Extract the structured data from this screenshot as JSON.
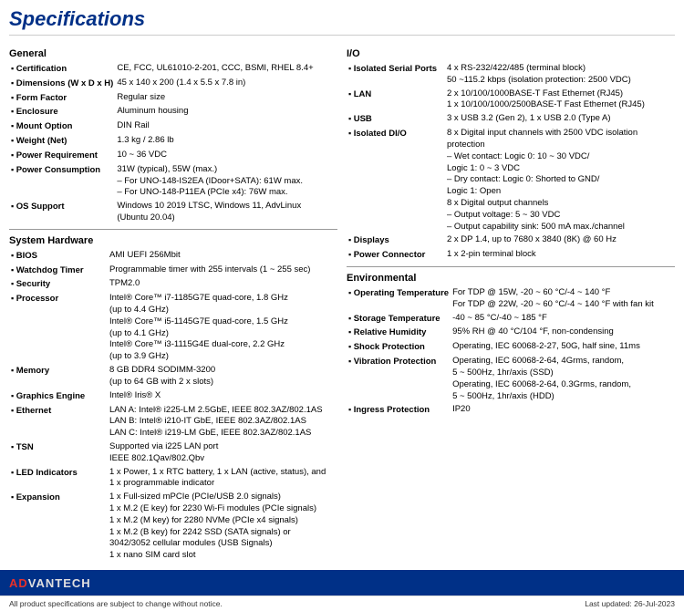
{
  "title": "Specifications",
  "left": {
    "general": {
      "heading": "General",
      "rows": [
        {
          "label": "Certification",
          "value": "CE, FCC, UL61010-2-201, CCC, BSMI, RHEL 8.4+"
        },
        {
          "label": "Dimensions (W x D x H)",
          "value": "45 x 140 x 200 (1.4 x 5.5 x 7.8 in)"
        },
        {
          "label": "Form Factor",
          "value": "Regular size"
        },
        {
          "label": "Enclosure",
          "value": "Aluminum housing"
        },
        {
          "label": "Mount Option",
          "value": "DIN Rail"
        },
        {
          "label": "Weight (Net)",
          "value": "1.3 kg / 2.86 lb"
        },
        {
          "label": "Power Requirement",
          "value": "10 ~ 36 VDC"
        },
        {
          "label": "Power Consumption",
          "value": "31W (typical), 55W (max.)\n– For UNO-148-IS2EA (IDoor+SATA): 61W max.\n– For UNO-148-P11EA (PCIe x4): 76W max."
        },
        {
          "label": "OS Support",
          "value": "Windows 10 2019 LTSC, Windows 11, AdvLinux\n(Ubuntu 20.04)"
        }
      ]
    },
    "system": {
      "heading": "System Hardware",
      "rows": [
        {
          "label": "BIOS",
          "value": "AMI UEFI 256Mbit"
        },
        {
          "label": "Watchdog Timer",
          "value": "Programmable timer with 255 intervals (1 ~ 255 sec)"
        },
        {
          "label": "Security",
          "value": "TPM2.0"
        },
        {
          "label": "Processor",
          "value": "Intel® Core™ i7-1185G7E quad-core, 1.8 GHz\n(up to 4.4 GHz)\nIntel® Core™ i5-1145G7E quad-core, 1.5 GHz\n(up to 4.1 GHz)\nIntel® Core™ i3-1115G4E dual-core, 2.2 GHz\n(up to 3.9 GHz)"
        },
        {
          "label": "Memory",
          "value": "8 GB DDR4 SODIMM-3200\n(up to 64 GB with 2 x slots)"
        },
        {
          "label": "Graphics Engine",
          "value": "Intel® Iris® X"
        },
        {
          "label": "Ethernet",
          "value": "LAN A: Intel® i225-LM 2.5GbE, IEEE 802.3AZ/802.1AS\nLAN B: Intel® i210-IT GbE, IEEE 802.3AZ/802.1AS\nLAN C: Intel® i219-LM GbE, IEEE 802.3AZ/802.1AS"
        },
        {
          "label": "TSN",
          "value": "Supported via i225 LAN port\nIEEE 802.1Qav/802.Qbv"
        },
        {
          "label": "LED Indicators",
          "value": "1 x Power, 1 x RTC battery, 1 x LAN (active, status), and\n1 x programmable indicator"
        },
        {
          "label": "Expansion",
          "value": "1 x Full-sized mPCIe (PCIe/USB 2.0 signals)\n1 x M.2 (E key) for 2230 Wi-Fi modules (PCIe signals)\n1 x M.2 (M key) for 2280 NVMe (PCIe x4 signals)\n1 x M.2 (B key) for 2242 SSD (SATA signals) or\n3042/3052 cellular modules (USB Signals)\n1 x nano SIM card slot"
        }
      ]
    }
  },
  "right": {
    "io": {
      "heading": "I/O",
      "rows": [
        {
          "label": "Isolated Serial Ports",
          "value": "4 x RS-232/422/485 (terminal block)\n50 ~115.2 kbps (isolation protection: 2500 VDC)"
        },
        {
          "label": "LAN",
          "value": "2 x 10/100/1000BASE-T Fast Ethernet (RJ45)\n1 x 10/100/1000/2500BASE-T Fast Ethernet (RJ45)"
        },
        {
          "label": "USB",
          "value": "3 x USB 3.2 (Gen 2), 1 x USB 2.0 (Type A)"
        },
        {
          "label": "Isolated DI/O",
          "value": "8 x Digital input channels with 2500 VDC isolation\nprotection\n– Wet contact: Logic 0: 10 ~ 30 VDC/\n  Logic 1: 0 ~ 3 VDC\n– Dry contact: Logic 0: Shorted to GND/\n  Logic 1: Open\n8 x Digital output channels\n– Output voltage: 5 ~ 30 VDC\n– Output capability sink: 500 mA max./channel"
        },
        {
          "label": "Displays",
          "value": "2 x DP 1.4, up to 7680 x 3840 (8K) @ 60 Hz"
        },
        {
          "label": "Power Connector",
          "value": "1 x 2-pin terminal block"
        }
      ]
    },
    "environmental": {
      "heading": "Environmental",
      "rows": [
        {
          "label": "Operating Temperature",
          "value": "For TDP @ 15W, -20 ~ 60 °C/-4 ~ 140 °F\nFor TDP @ 22W, -20 ~ 60 °C/-4 ~ 140 °F with fan kit"
        },
        {
          "label": "Storage Temperature",
          "value": "-40 ~ 85 °C/-40 ~ 185 °F"
        },
        {
          "label": "Relative Humidity",
          "value": "95% RH @ 40 °C/104 °F, non-condensing"
        },
        {
          "label": "Shock Protection",
          "value": "Operating, IEC 60068-2-27, 50G, half sine, 11ms"
        },
        {
          "label": "Vibration Protection",
          "value": "Operating, IEC 60068-2-64, 4Grms, random,\n5 ~ 500Hz, 1hr/axis (SSD)\nOperating, IEC 60068-2-64, 0.3Grms, random,\n5 ~ 500Hz, 1hr/axis (HDD)"
        },
        {
          "label": "Ingress Protection",
          "value": "IP20"
        }
      ]
    }
  },
  "footer": {
    "logo_prefix": "AD",
    "logo_brand": "ANTECH",
    "note_left": "All product specifications are subject to change without notice.",
    "note_right": "Last updated: 26-Jul-2023"
  }
}
